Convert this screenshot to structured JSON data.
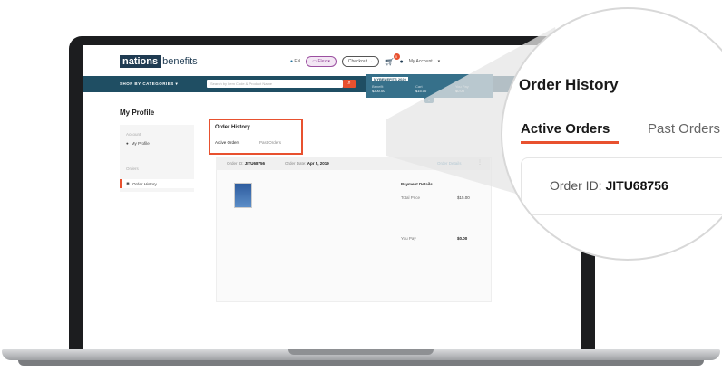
{
  "device": {
    "model": "MacBook Pro"
  },
  "header": {
    "brand_highlight": "nations",
    "brand_rest": "benefits",
    "lang": "EN",
    "flex_label": "Flex",
    "checkout_label": "Checkout",
    "cart_count": "0",
    "account_label": "My Account"
  },
  "nav": {
    "shop_categories": "SHOP BY CATEGORIES",
    "search_placeholder": "Search by Item Code & Product Name",
    "benefits_header": "MYBENEFITS 2020",
    "benefit_cols": [
      {
        "label": "Benefit",
        "value": "$300.00"
      },
      {
        "label": "Cart",
        "value": "$15.00"
      },
      {
        "label": "You Pay",
        "value": "$0.00"
      }
    ]
  },
  "profile": {
    "title": "My Profile",
    "sidebar": {
      "account_section": "Account",
      "my_profile": "My Profile",
      "orders_section": "Orders",
      "order_history": "Order History"
    }
  },
  "order_history": {
    "title": "Order History",
    "tabs": [
      "Active Orders",
      "Past Orders"
    ],
    "order": {
      "id_label": "Order ID:",
      "id_value": "JITU68756",
      "date_label": "Order Date:",
      "date_value": "Apr 5, 2019",
      "details_link": "Order Details"
    },
    "payment": {
      "header": "Payment Details",
      "total_label": "Total Price",
      "total_value": "$15.00",
      "pay_label": "You Pay",
      "pay_value": "$0.00"
    }
  },
  "zoom": {
    "title": "Order History",
    "tab_active": "Active Orders",
    "tab_inactive": "Past Orders",
    "order_id_label": "Order ID:",
    "order_id_value": "JITU68756"
  },
  "colors": {
    "accent": "#e8512f",
    "nav": "#1f4e63",
    "brand": "#1f3b52"
  }
}
